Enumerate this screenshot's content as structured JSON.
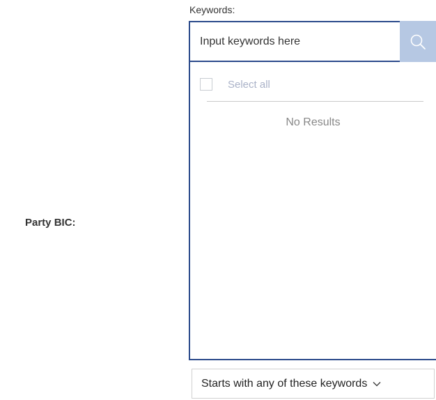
{
  "form": {
    "field_label": "Party BIC:",
    "keywords_label": "Keywords:",
    "search_placeholder": "Input keywords here",
    "select_all_label": "Select all",
    "no_results_text": "No Results",
    "match_mode_value": "Starts with any of these keywords"
  },
  "icons": {
    "search": "search-icon",
    "dropdown": "chevron-down-icon"
  },
  "colors": {
    "input_border": "#2b4a8b",
    "search_button_bg": "#b6c8e3",
    "muted_text": "#aab2c8"
  }
}
